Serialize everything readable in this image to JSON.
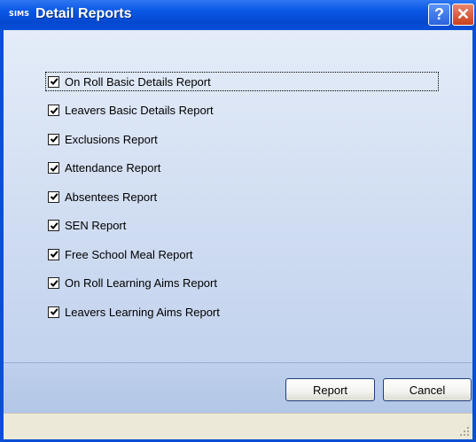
{
  "window": {
    "title": "Detail Reports",
    "app_logo": "SIMS",
    "help_label": "?",
    "close_label": "✕"
  },
  "checklist": [
    {
      "label": "On Roll Basic Details Report",
      "checked": true,
      "focused": true
    },
    {
      "label": "Leavers Basic Details Report",
      "checked": true
    },
    {
      "label": "Exclusions Report",
      "checked": true
    },
    {
      "label": "Attendance Report",
      "checked": true
    },
    {
      "label": "Absentees Report",
      "checked": true
    },
    {
      "label": "SEN Report",
      "checked": true
    },
    {
      "label": "Free School Meal Report",
      "checked": true
    },
    {
      "label": "On Roll Learning Aims Report",
      "checked": true
    },
    {
      "label": "Leavers Learning Aims Report",
      "checked": true
    }
  ],
  "buttons": {
    "report_label": "Report",
    "cancel_label": "Cancel"
  },
  "icons": {
    "help": "help-icon",
    "close": "close-icon",
    "checkmark": "checkmark-icon",
    "resize_grip": "resize-grip-icon"
  },
  "colors": {
    "titlebar": "#0548d0",
    "content_bg": "#dde7f5",
    "close_button": "#c8401b",
    "help_button": "#2a63dc"
  }
}
